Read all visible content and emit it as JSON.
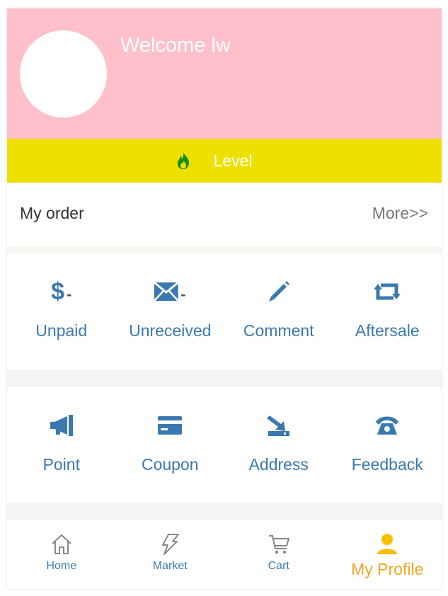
{
  "header": {
    "welcome": "Welcome lw"
  },
  "level": {
    "label": "Level"
  },
  "order": {
    "title": "My order",
    "more": "More>>"
  },
  "order_status": [
    {
      "label": "Unpaid",
      "icon": "dollar-icon",
      "badge": "-"
    },
    {
      "label": "Unreceived",
      "icon": "envelope-icon",
      "badge": "-"
    },
    {
      "label": "Comment",
      "icon": "pencil-icon"
    },
    {
      "label": "Aftersale",
      "icon": "retweet-icon"
    }
  ],
  "services": [
    {
      "label": "Point",
      "icon": "megaphone-icon"
    },
    {
      "label": "Coupon",
      "icon": "credit-card-icon"
    },
    {
      "label": "Address",
      "icon": "download-icon"
    },
    {
      "label": "Feedback",
      "icon": "phone-icon"
    }
  ],
  "tabbar": [
    {
      "label": "Home",
      "icon": "home-icon"
    },
    {
      "label": "Market",
      "icon": "lightning-icon"
    },
    {
      "label": "Cart",
      "icon": "cart-icon"
    },
    {
      "label": "My Profile",
      "icon": "user-icon",
      "active": true
    }
  ],
  "colors": {
    "header_bg": "#ffc0cb",
    "level_bg": "#eee000",
    "accent_blue": "#3a79b0",
    "active_tab": "#f5a623",
    "fire_icon": "#1a8a1a"
  }
}
